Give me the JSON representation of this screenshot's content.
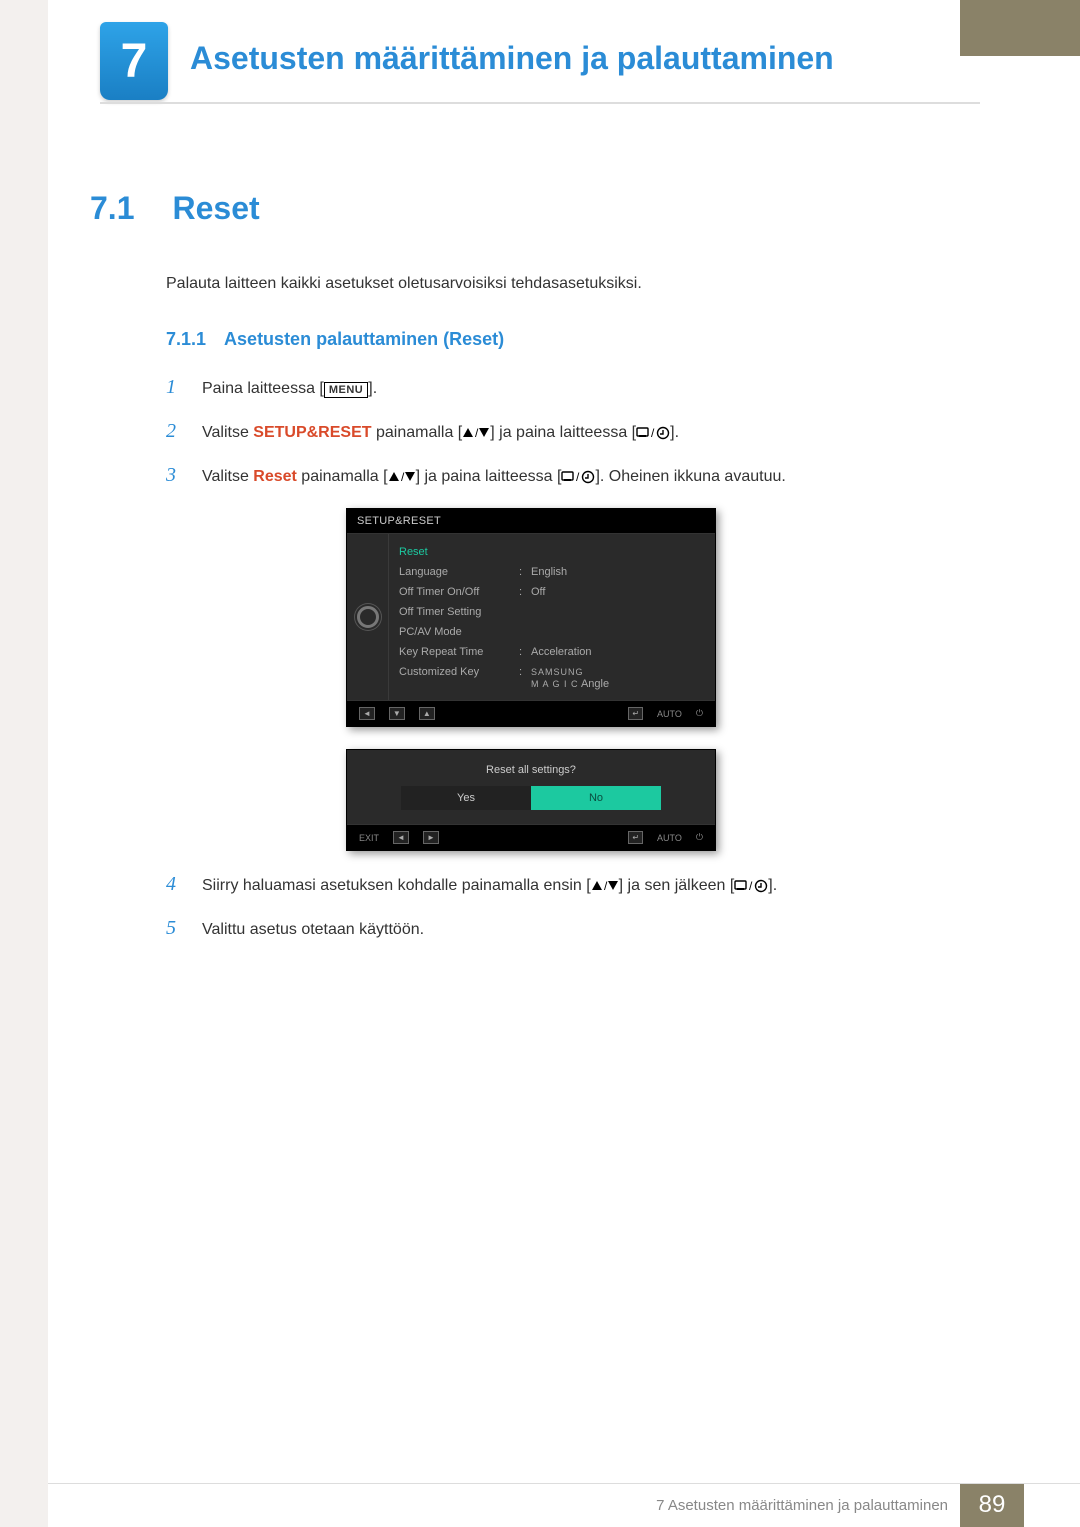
{
  "chapter": {
    "number": "7",
    "title": "Asetusten määrittäminen ja palauttaminen"
  },
  "h2": {
    "num": "7.1",
    "title": "Reset"
  },
  "intro": "Palauta laitteen kaikki asetukset oletusarvoisiksi tehdasasetuksiksi.",
  "h3": {
    "num": "7.1.1",
    "title": "Asetusten palauttaminen (Reset)"
  },
  "steps": {
    "s1": {
      "num": "1",
      "pre": "Paina laitteessa [",
      "menu": "MENU",
      "post": "]."
    },
    "s2": {
      "num": "2",
      "pre": "Valitse ",
      "kw": "SETUP&RESET",
      "mid": " painamalla [",
      "mid2": "] ja paina laitteessa [",
      "post": "]."
    },
    "s3": {
      "num": "3",
      "pre": "Valitse ",
      "kw": "Reset",
      "mid": " painamalla [",
      "mid2": "] ja paina laitteessa [",
      "post": "]. Oheinen ikkuna avautuu."
    },
    "s4": {
      "num": "4",
      "pre": "Siirry haluamasi asetuksen kohdalle painamalla ensin [",
      "mid": "] ja sen jälkeen [",
      "post": "]."
    },
    "s5": {
      "num": "5",
      "text": "Valittu asetus otetaan käyttöön."
    }
  },
  "osd": {
    "header": "SETUP&RESET",
    "rows": [
      {
        "label": "Reset",
        "val": "",
        "active": true
      },
      {
        "label": "Language",
        "val": "English"
      },
      {
        "label": "Off Timer On/Off",
        "val": "Off"
      },
      {
        "label": "Off Timer Setting",
        "val": ""
      },
      {
        "label": "PC/AV Mode",
        "val": ""
      },
      {
        "label": "Key Repeat Time",
        "val": "Acceleration"
      },
      {
        "label": "Customized Key",
        "val": "Angle",
        "magic": true
      }
    ],
    "footer": {
      "auto": "AUTO"
    }
  },
  "dialog": {
    "question": "Reset all settings?",
    "yes": "Yes",
    "no": "No",
    "exit": "EXIT",
    "auto": "AUTO"
  },
  "footer": {
    "text": "7 Asetusten määrittäminen ja palauttaminen",
    "page": "89"
  }
}
